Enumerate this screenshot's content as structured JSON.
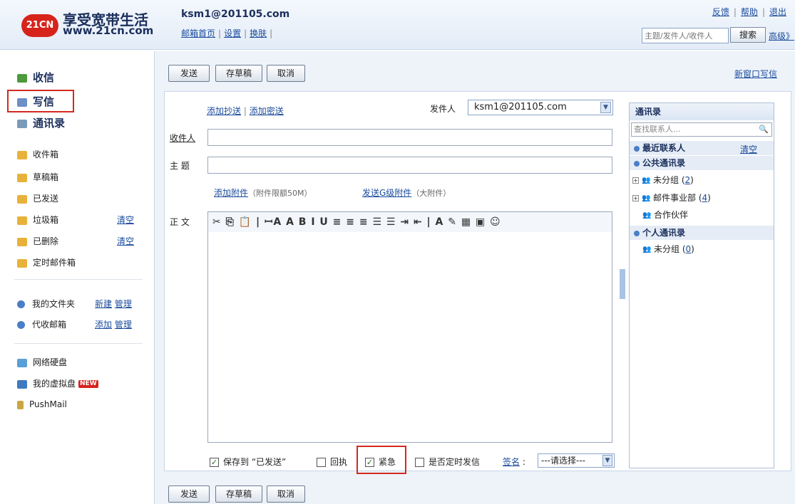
{
  "header": {
    "logo_badge": "21CN",
    "logo_title": "享受宽带生活",
    "logo_url": "www.21cn.com",
    "user_email": "ksm1@201105.com",
    "nav": [
      "邮箱首页",
      "设置",
      "换肤"
    ],
    "util_links": [
      "反馈",
      "帮助",
      "退出"
    ],
    "search_placeholder": "主题/发件人/收件人",
    "search_button": "搜索",
    "advanced_link": "高级》"
  },
  "sidebar": {
    "inbox_label": "收信",
    "compose_label": "写信",
    "contacts_label": "通讯录",
    "folders": [
      {
        "label": "收件箱"
      },
      {
        "label": "草稿箱"
      },
      {
        "label": "已发送"
      },
      {
        "label": "垃圾箱",
        "action": "清空"
      },
      {
        "label": "已删除",
        "action": "清空"
      },
      {
        "label": "定时邮件箱"
      }
    ],
    "my_folders": {
      "label": "我的文件夹",
      "actions": [
        "新建",
        "管理"
      ]
    },
    "proxy_mail": {
      "label": "代收邮箱",
      "actions": [
        "添加",
        "管理"
      ]
    },
    "netdisk": "网络硬盘",
    "vdisk": "我的虚拟盘",
    "vdisk_badge": "NEW",
    "pushmail": "PushMail"
  },
  "compose": {
    "send": "发送",
    "save_draft": "存草稿",
    "cancel": "取消",
    "new_window": "新窗口写信",
    "add_cc": "添加抄送",
    "add_bcc": "添加密送",
    "sender_label": "发件人",
    "sender_value": "ksm1@201105.com",
    "to_label": "收件人",
    "to_value": "",
    "subject_label": "主 题",
    "subject_value": "",
    "add_attachment": "添加附件",
    "attachment_limit": "（附件限额50M）",
    "send_large": "发送G级附件",
    "large_note": "（大附件）",
    "body_label": "正 文",
    "toolbar_glyphs": "✂ ⎘ 📋 | ꟷA A B I U ≡ ≡ ≡ ☰ ☰ ⇥ ⇤ | A ✎ ▦ ▣ ☺",
    "save_sent": "保存到 “已发送”",
    "save_sent_checked": true,
    "receipt": "回执",
    "receipt_checked": false,
    "urgent": "紧急",
    "urgent_checked": true,
    "scheduled": "是否定时发信",
    "scheduled_checked": false,
    "signature_label": "签名",
    "signature_value": "---请选择---"
  },
  "contacts": {
    "title": "通讯录",
    "search_placeholder": "查找联系人...",
    "recent": "最近联系人",
    "recent_clear": "清空",
    "public": "公共通讯录",
    "public_groups": [
      {
        "name": "未分组",
        "count": "2"
      },
      {
        "name": "邮件事业部",
        "count": "4"
      },
      {
        "name": "合作伙伴",
        "count": ""
      }
    ],
    "personal": "个人通讯录",
    "personal_groups": [
      {
        "name": "未分组",
        "count": "0"
      }
    ]
  }
}
